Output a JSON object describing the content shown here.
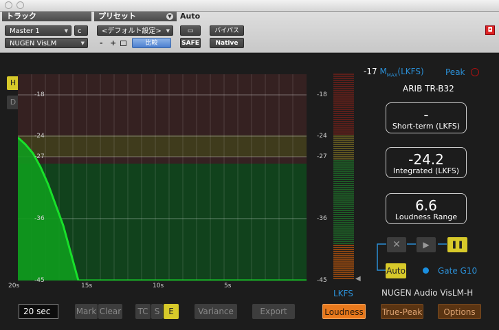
{
  "window": {
    "close": "",
    "min": ""
  },
  "header": {
    "track_title": "トラック",
    "preset_title": "プリセット",
    "auto_title": "Auto",
    "track_name": "Master 1",
    "track_channel": "c",
    "plugin_name": "NUGEN VisLM",
    "preset_value": "<デフォルト設定>",
    "minus": "-",
    "plus": "+",
    "compare": "比較",
    "safe": "SAFE",
    "bypass": "バイパス",
    "native": "Native"
  },
  "plugin": {
    "side_buttons": {
      "h": "H",
      "d": "D"
    },
    "y_ticks_left": [
      "-18",
      "-24",
      "-27",
      "-36",
      "-45"
    ],
    "x_ticks": [
      "20s",
      "15s",
      "10s",
      "5s"
    ],
    "meter_ticks": [
      "-18",
      "-24",
      "-27",
      "-36",
      "-45"
    ],
    "meter_unit": "LKFS",
    "mmax_value": "-17",
    "mmax_prefix": "M",
    "mmax_sub": "MAX",
    "mmax_unit": "(LKFS)",
    "peak_label": "Peak",
    "standard": "ARIB TR-B32",
    "short_term": {
      "value": "-",
      "caption": "Short-term (LKFS)"
    },
    "integrated": {
      "value": "-24.2",
      "caption": "Integrated (LKFS)"
    },
    "range": {
      "value": "6.6",
      "caption": "Loudness Range"
    },
    "transport": {
      "stop": "✕",
      "play": "▶",
      "pause": "❚❚"
    },
    "auto": "Auto",
    "gate": "Gate G10",
    "product": "NUGEN Audio VisLM-H",
    "time_window": "20 sec",
    "mark": "Mark",
    "clear": "Clear",
    "tc": "TC",
    "s": "S",
    "e": "E",
    "variance": "Variance",
    "export": "Export",
    "loudness": "Loudness",
    "true_peak": "True-Peak",
    "options": "Options"
  },
  "colors": {
    "accent_yellow": "#d7c92a",
    "curve_green": "#18e02a",
    "orange": "#e8791d",
    "blue": "#2b8fd6"
  },
  "graph": {
    "y_min": -45,
    "y_max": -15,
    "curve_lkfs": [
      -24.2,
      -25.2,
      -26.5,
      -28.5,
      -31,
      -34,
      -37,
      -41,
      -45,
      -45,
      -45,
      -45,
      -45,
      -45,
      -45,
      -45,
      -45,
      -45
    ]
  }
}
